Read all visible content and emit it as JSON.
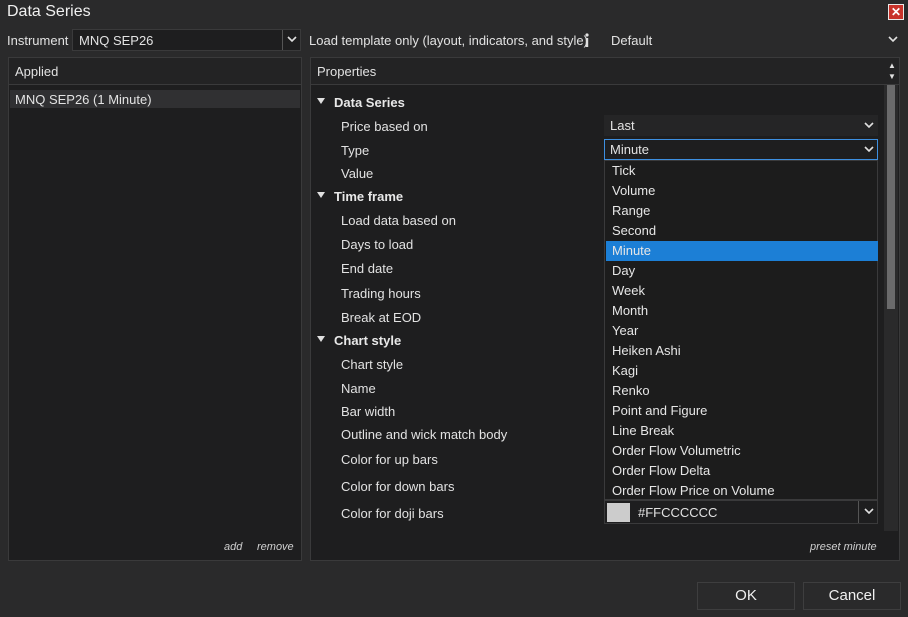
{
  "window": {
    "title": "Data Series",
    "close_icon": "close-icon"
  },
  "toolbar": {
    "instrument_label": "Instrument",
    "instrument_value": "MNQ SEP26",
    "template_label": "Load template only (layout, indicators, and style)",
    "info_icon": "info-icon",
    "template_value": "Default"
  },
  "applied": {
    "header": "Applied",
    "items": [
      "MNQ SEP26 (1 Minute)"
    ],
    "add_label": "add",
    "remove_label": "remove"
  },
  "properties": {
    "header": "Properties",
    "categories": [
      {
        "label": "Data Series",
        "props": [
          "Price based on",
          "Type",
          "Value"
        ]
      },
      {
        "label": "Time frame",
        "props": [
          "Load data based on",
          "Days to load",
          "End date",
          "Trading hours",
          "Break at EOD"
        ]
      },
      {
        "label": "Chart style",
        "props": [
          "Chart style",
          "Name",
          "Bar width",
          "Outline and wick match body",
          "Color for up bars",
          "Color for down bars",
          "Color for doji bars"
        ]
      }
    ],
    "price_based_on": "Last",
    "type": "Minute",
    "doji_color": "#FFCCCCCC",
    "preset_label": "preset minute"
  },
  "type_dropdown": {
    "options": [
      "Tick",
      "Volume",
      "Range",
      "Second",
      "Minute",
      "Day",
      "Week",
      "Month",
      "Year",
      "Heiken Ashi",
      "Kagi",
      "Renko",
      "Point and Figure",
      "Line Break",
      "Order Flow Volumetric",
      "Order Flow Delta",
      "Order Flow Price on Volume"
    ],
    "selected": "Minute"
  },
  "buttons": {
    "ok": "OK",
    "cancel": "Cancel"
  },
  "colors": {
    "accent": "#1c7fd6",
    "focus_border": "#3d8fe0",
    "close": "#c8322a",
    "doji_swatch": "#cccccc"
  }
}
